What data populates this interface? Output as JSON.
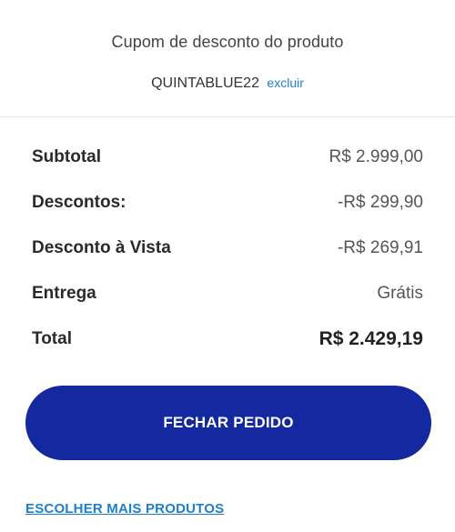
{
  "coupon": {
    "title": "Cupom de desconto do produto",
    "code": "QUINTABLUE22",
    "remove_label": "excluir"
  },
  "summary": {
    "rows": [
      {
        "label": "Subtotal",
        "value": "R$ 2.999,00"
      },
      {
        "label": "Descontos:",
        "value": "-R$ 299,90"
      },
      {
        "label": "Desconto à Vista",
        "value": "-R$ 269,91"
      },
      {
        "label": "Entrega",
        "value": "Grátis"
      },
      {
        "label": "Total",
        "value": "R$ 2.429,19"
      }
    ]
  },
  "actions": {
    "checkout_label": "FECHAR PEDIDO",
    "more_products_label": "ESCOLHER MAIS PRODUTOS"
  },
  "colors": {
    "primary": "#1428a0",
    "link": "#1f7fc8"
  }
}
